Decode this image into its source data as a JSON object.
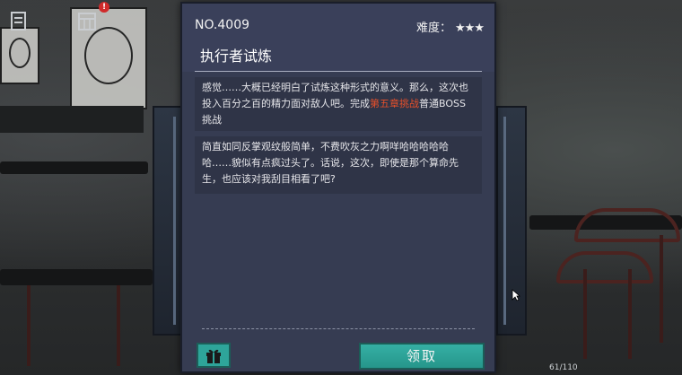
{
  "hud": {
    "journal_icon": "journal-icon",
    "calendar_icon": "calendar-icon",
    "badge": "!"
  },
  "task": {
    "number": "NO.4009",
    "difficulty_label": "难度：",
    "difficulty_stars": "★★★",
    "title": "执行者试炼",
    "desc_part1": "感觉……大概已经明白了试炼这种形式的意义。那么，这次也投入百分之百的精力面对敌人吧。完成",
    "desc_highlight": "第五章挑战",
    "desc_part2": "普通BOSS挑战",
    "dialogue": "简直如同反掌观纹般简单，不费吹灰之力啊咩哈哈哈哈哈哈……貌似有点疯过头了。话说，这次，即使是那个算命先生，也应该对我刮目相看了吧?",
    "claim_label": "领取",
    "gift_icon": "gift-icon"
  },
  "bottom_counter": "61/110",
  "colors": {
    "panel": "#363c52",
    "accent_button": "#2ea59a",
    "highlight": "#e8502a"
  }
}
